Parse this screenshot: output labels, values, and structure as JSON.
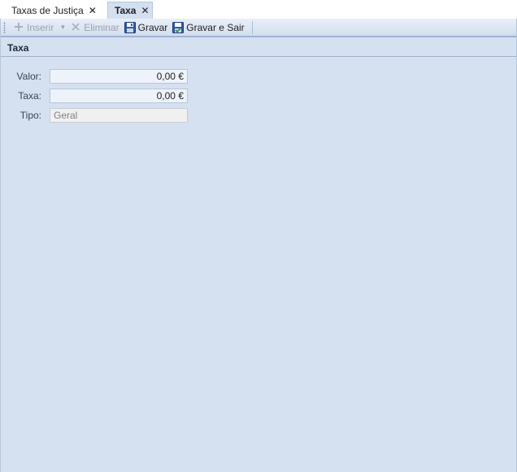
{
  "tabs": [
    {
      "label": "Taxas de Justiça",
      "active": false
    },
    {
      "label": "Taxa",
      "active": true
    }
  ],
  "toolbar": {
    "insert_label": "Inserir",
    "delete_label": "Eliminar",
    "save_label": "Gravar",
    "save_exit_label": "Gravar e Sair"
  },
  "section": {
    "title": "Taxa"
  },
  "form": {
    "valor": {
      "label": "Valor:",
      "value": "0,00 €"
    },
    "taxa": {
      "label": "Taxa:",
      "value": "0,00 €"
    },
    "tipo": {
      "label": "Tipo:",
      "value": "Geral"
    }
  },
  "colors": {
    "frame_bg": "#d5e0f0",
    "active_tab_bg": "#d4dff0",
    "toolbar_border": "#9db3d6",
    "field_bg": "#eef3fb",
    "readonly_field_bg": "#f0f0f0"
  },
  "icons": {
    "insert": "plus-icon",
    "delete": "x-icon",
    "save": "floppy-disk-icon",
    "save_exit": "floppy-disk-check-icon",
    "tab_close": "close-icon"
  }
}
